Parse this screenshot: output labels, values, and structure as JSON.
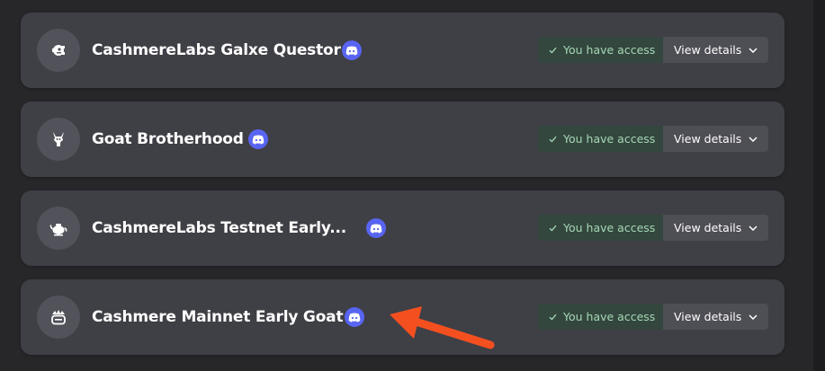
{
  "roles": [
    {
      "title": "CashmereLabs Galxe Questor",
      "icon": "robot-fish-icon",
      "access_label": "You have access",
      "details_label": "View details"
    },
    {
      "title": "Goat Brotherhood",
      "icon": "goat-icon",
      "access_label": "You have access",
      "details_label": "View details"
    },
    {
      "title": "CashmereLabs Testnet Early...",
      "icon": "teapot-icon",
      "access_label": "You have access",
      "details_label": "View details"
    },
    {
      "title": "Cashmere Mainnet Early Goat",
      "icon": "crown-box-icon",
      "access_label": "You have access",
      "details_label": "View details"
    }
  ],
  "colors": {
    "background": "#27272a",
    "card": "#3f3f46",
    "discord": "#5865f2",
    "access_bg": "#33473e",
    "access_text": "#a7d7b6",
    "arrow": "#f4501f"
  },
  "annotation": {
    "type": "red-arrow-icon"
  }
}
